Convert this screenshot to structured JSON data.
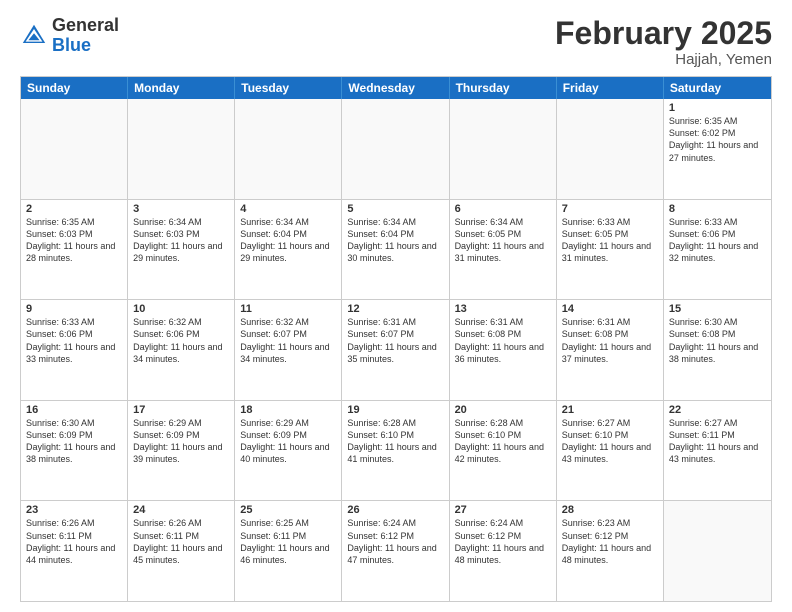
{
  "header": {
    "logo_general": "General",
    "logo_blue": "Blue",
    "month_title": "February 2025",
    "subtitle": "Hajjah, Yemen"
  },
  "days_of_week": [
    "Sunday",
    "Monday",
    "Tuesday",
    "Wednesday",
    "Thursday",
    "Friday",
    "Saturday"
  ],
  "weeks": [
    [
      {
        "day": "",
        "text": ""
      },
      {
        "day": "",
        "text": ""
      },
      {
        "day": "",
        "text": ""
      },
      {
        "day": "",
        "text": ""
      },
      {
        "day": "",
        "text": ""
      },
      {
        "day": "",
        "text": ""
      },
      {
        "day": "1",
        "text": "Sunrise: 6:35 AM\nSunset: 6:02 PM\nDaylight: 11 hours and 27 minutes."
      }
    ],
    [
      {
        "day": "2",
        "text": "Sunrise: 6:35 AM\nSunset: 6:03 PM\nDaylight: 11 hours and 28 minutes."
      },
      {
        "day": "3",
        "text": "Sunrise: 6:34 AM\nSunset: 6:03 PM\nDaylight: 11 hours and 29 minutes."
      },
      {
        "day": "4",
        "text": "Sunrise: 6:34 AM\nSunset: 6:04 PM\nDaylight: 11 hours and 29 minutes."
      },
      {
        "day": "5",
        "text": "Sunrise: 6:34 AM\nSunset: 6:04 PM\nDaylight: 11 hours and 30 minutes."
      },
      {
        "day": "6",
        "text": "Sunrise: 6:34 AM\nSunset: 6:05 PM\nDaylight: 11 hours and 31 minutes."
      },
      {
        "day": "7",
        "text": "Sunrise: 6:33 AM\nSunset: 6:05 PM\nDaylight: 11 hours and 31 minutes."
      },
      {
        "day": "8",
        "text": "Sunrise: 6:33 AM\nSunset: 6:06 PM\nDaylight: 11 hours and 32 minutes."
      }
    ],
    [
      {
        "day": "9",
        "text": "Sunrise: 6:33 AM\nSunset: 6:06 PM\nDaylight: 11 hours and 33 minutes."
      },
      {
        "day": "10",
        "text": "Sunrise: 6:32 AM\nSunset: 6:06 PM\nDaylight: 11 hours and 34 minutes."
      },
      {
        "day": "11",
        "text": "Sunrise: 6:32 AM\nSunset: 6:07 PM\nDaylight: 11 hours and 34 minutes."
      },
      {
        "day": "12",
        "text": "Sunrise: 6:31 AM\nSunset: 6:07 PM\nDaylight: 11 hours and 35 minutes."
      },
      {
        "day": "13",
        "text": "Sunrise: 6:31 AM\nSunset: 6:08 PM\nDaylight: 11 hours and 36 minutes."
      },
      {
        "day": "14",
        "text": "Sunrise: 6:31 AM\nSunset: 6:08 PM\nDaylight: 11 hours and 37 minutes."
      },
      {
        "day": "15",
        "text": "Sunrise: 6:30 AM\nSunset: 6:08 PM\nDaylight: 11 hours and 38 minutes."
      }
    ],
    [
      {
        "day": "16",
        "text": "Sunrise: 6:30 AM\nSunset: 6:09 PM\nDaylight: 11 hours and 38 minutes."
      },
      {
        "day": "17",
        "text": "Sunrise: 6:29 AM\nSunset: 6:09 PM\nDaylight: 11 hours and 39 minutes."
      },
      {
        "day": "18",
        "text": "Sunrise: 6:29 AM\nSunset: 6:09 PM\nDaylight: 11 hours and 40 minutes."
      },
      {
        "day": "19",
        "text": "Sunrise: 6:28 AM\nSunset: 6:10 PM\nDaylight: 11 hours and 41 minutes."
      },
      {
        "day": "20",
        "text": "Sunrise: 6:28 AM\nSunset: 6:10 PM\nDaylight: 11 hours and 42 minutes."
      },
      {
        "day": "21",
        "text": "Sunrise: 6:27 AM\nSunset: 6:10 PM\nDaylight: 11 hours and 43 minutes."
      },
      {
        "day": "22",
        "text": "Sunrise: 6:27 AM\nSunset: 6:11 PM\nDaylight: 11 hours and 43 minutes."
      }
    ],
    [
      {
        "day": "23",
        "text": "Sunrise: 6:26 AM\nSunset: 6:11 PM\nDaylight: 11 hours and 44 minutes."
      },
      {
        "day": "24",
        "text": "Sunrise: 6:26 AM\nSunset: 6:11 PM\nDaylight: 11 hours and 45 minutes."
      },
      {
        "day": "25",
        "text": "Sunrise: 6:25 AM\nSunset: 6:11 PM\nDaylight: 11 hours and 46 minutes."
      },
      {
        "day": "26",
        "text": "Sunrise: 6:24 AM\nSunset: 6:12 PM\nDaylight: 11 hours and 47 minutes."
      },
      {
        "day": "27",
        "text": "Sunrise: 6:24 AM\nSunset: 6:12 PM\nDaylight: 11 hours and 48 minutes."
      },
      {
        "day": "28",
        "text": "Sunrise: 6:23 AM\nSunset: 6:12 PM\nDaylight: 11 hours and 48 minutes."
      },
      {
        "day": "",
        "text": ""
      }
    ]
  ]
}
